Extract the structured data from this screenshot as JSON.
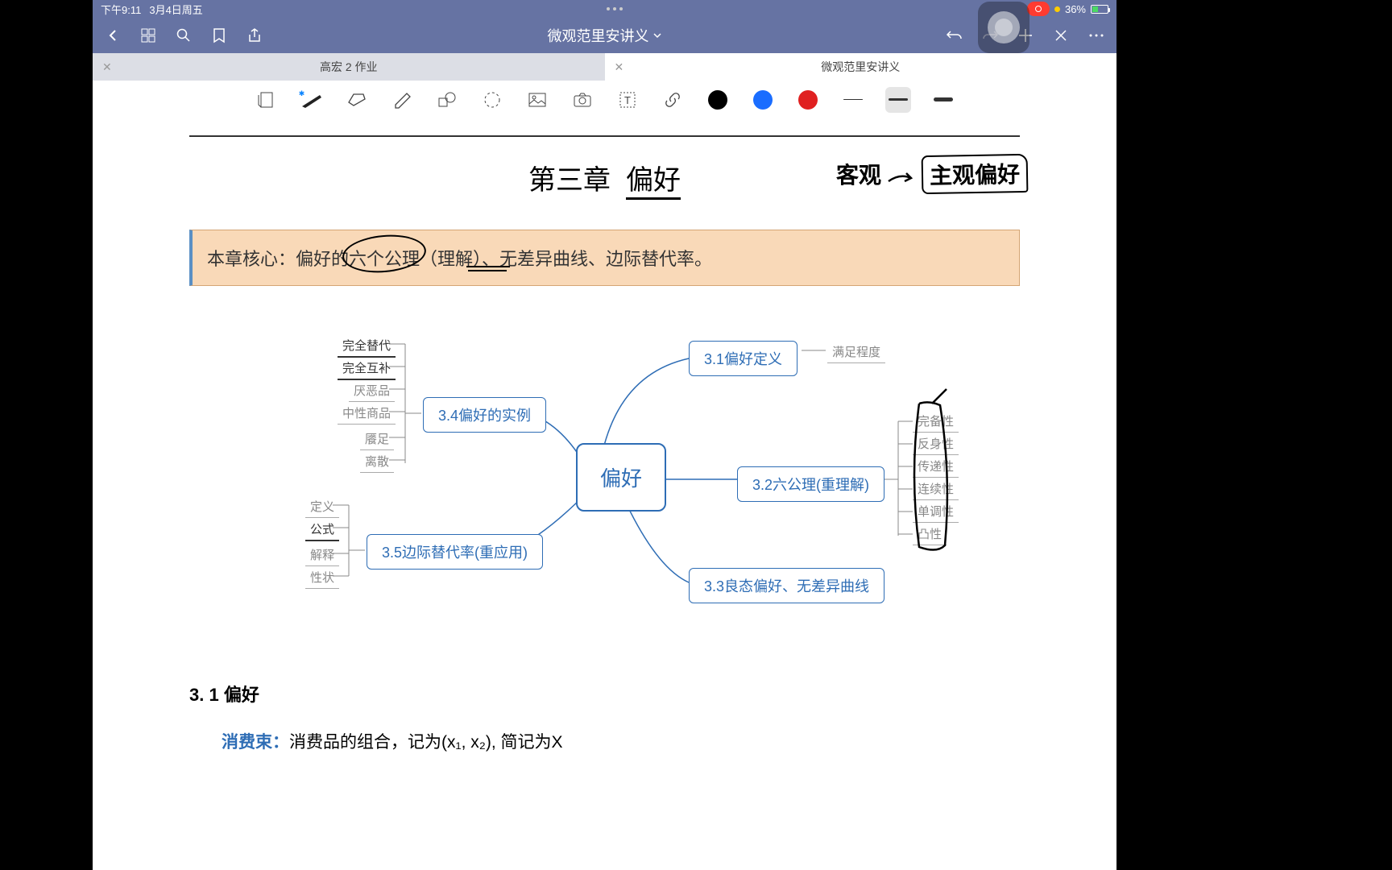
{
  "status": {
    "time": "下午9:11",
    "date": "3月4日周五",
    "battery": "36%"
  },
  "nav": {
    "title": "微观范里安讲义"
  },
  "tabs": {
    "t1": "高宏 2 作业",
    "t2": "微观范里安讲义"
  },
  "tools": {
    "colors": {
      "black": "#000",
      "blue": "#1a6dff",
      "red": "#e02020"
    }
  },
  "doc": {
    "chapter_pre": "第三章",
    "chapter_title": "偏好",
    "hand_a": "客观",
    "hand_b": "主观偏好",
    "core": "本章核心：偏好的六个公理（理解）、无差异曲线、边际替代率。",
    "map": {
      "center": "偏好",
      "n31": "3.1偏好定义",
      "n31_leaf": "满足程度",
      "n32": "3.2六公理(重理解)",
      "n32_leaves": [
        "完备性",
        "反身性",
        "传递性",
        "连续性",
        "单调性",
        "凸性"
      ],
      "n33": "3.3良态偏好、无差异曲线",
      "n34": "3.4偏好的实例",
      "n34_leaves": [
        "完全替代",
        "完全互补",
        "厌恶品",
        "中性商品",
        "餍足",
        "离散"
      ],
      "n35": "3.5边际替代率(重应用)",
      "n35_leaves": [
        "定义",
        "公式",
        "解释",
        "性状"
      ]
    },
    "sec_num": "3. 1",
    "sec_title": "偏好",
    "body_term": "消费束：",
    "body_text": "消费品的组合，记为(x₁, x₂), 简记为X"
  }
}
